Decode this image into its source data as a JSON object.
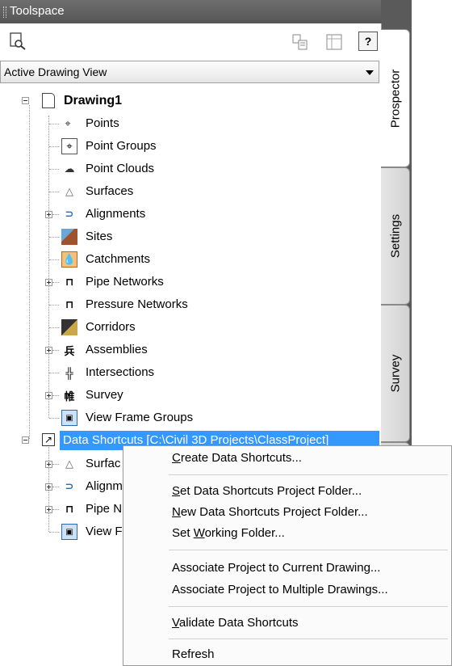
{
  "window": {
    "title": "Toolspace"
  },
  "view_selector": {
    "value": "Active Drawing View"
  },
  "tabs": [
    {
      "label": "Prospector",
      "active": true
    },
    {
      "label": "Settings",
      "active": false
    },
    {
      "label": "Survey",
      "active": false
    }
  ],
  "toolbar": {
    "help_label": "?"
  },
  "tree": {
    "root": "Drawing1",
    "items": [
      {
        "label": "Points",
        "icon": "points-icon",
        "expandable": false
      },
      {
        "label": "Point Groups",
        "icon": "point-groups-icon",
        "expandable": false
      },
      {
        "label": "Point Clouds",
        "icon": "point-clouds-icon",
        "expandable": false
      },
      {
        "label": "Surfaces",
        "icon": "surfaces-icon",
        "expandable": false
      },
      {
        "label": "Alignments",
        "icon": "alignments-icon",
        "expandable": true
      },
      {
        "label": "Sites",
        "icon": "sites-icon",
        "expandable": false
      },
      {
        "label": "Catchments",
        "icon": "catchments-icon",
        "expandable": false
      },
      {
        "label": "Pipe Networks",
        "icon": "pipe-networks-icon",
        "expandable": true
      },
      {
        "label": "Pressure Networks",
        "icon": "pressure-networks-icon",
        "expandable": false
      },
      {
        "label": "Corridors",
        "icon": "corridors-icon",
        "expandable": false
      },
      {
        "label": "Assemblies",
        "icon": "assemblies-icon",
        "expandable": true
      },
      {
        "label": "Intersections",
        "icon": "intersections-icon",
        "expandable": false
      },
      {
        "label": "Survey",
        "icon": "survey-icon",
        "expandable": true
      },
      {
        "label": "View Frame Groups",
        "icon": "view-frame-groups-icon",
        "expandable": false
      }
    ],
    "data_shortcuts": {
      "label": "Data Shortcuts [C:\\Civil 3D Projects\\ClassProject]",
      "children": [
        {
          "label": "Surfac",
          "icon": "surface-shortcut-icon",
          "expandable": true
        },
        {
          "label": "Alignm",
          "icon": "alignment-shortcut-icon",
          "expandable": true
        },
        {
          "label": "Pipe N",
          "icon": "pipe-network-shortcut-icon",
          "expandable": true
        },
        {
          "label": "View F",
          "icon": "view-frame-shortcut-icon",
          "expandable": false
        }
      ]
    }
  },
  "context_menu": {
    "items": [
      {
        "pre": "",
        "key": "C",
        "post": "reate Data Shortcuts..."
      },
      {
        "separator": true
      },
      {
        "pre": "",
        "key": "S",
        "post": "et Data Shortcuts Project Folder..."
      },
      {
        "pre": "",
        "key": "N",
        "post": "ew Data Shortcuts Project Folder..."
      },
      {
        "pre": "Set ",
        "key": "W",
        "post": "orking Folder..."
      },
      {
        "separator": true
      },
      {
        "pre": "Associate Project to Current Drawing...",
        "key": "",
        "post": ""
      },
      {
        "pre": "Associate Project to Multiple Drawings...",
        "key": "",
        "post": ""
      },
      {
        "separator": true
      },
      {
        "pre": "",
        "key": "V",
        "post": "alidate Data Shortcuts"
      },
      {
        "separator": true
      },
      {
        "pre": "Refresh",
        "key": "",
        "post": ""
      }
    ]
  }
}
